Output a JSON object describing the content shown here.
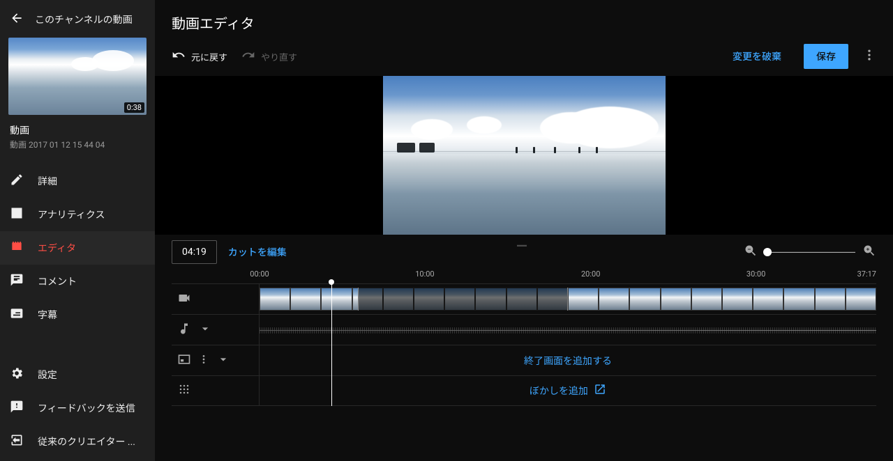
{
  "sidebar": {
    "back_label": "このチャンネルの動画",
    "thumb_duration": "0:38",
    "video_heading": "動画",
    "video_subtitle": "動画 2017 01 12 15 44 04",
    "items": [
      {
        "id": "details",
        "label": "詳細"
      },
      {
        "id": "analytics",
        "label": "アナリティクス"
      },
      {
        "id": "editor",
        "label": "エディタ"
      },
      {
        "id": "comments",
        "label": "コメント"
      },
      {
        "id": "subtitles",
        "label": "字幕"
      }
    ],
    "footer": [
      {
        "id": "settings",
        "label": "設定"
      },
      {
        "id": "feedback",
        "label": "フィードバックを送信"
      },
      {
        "id": "classic",
        "label": "従来のクリエイター ..."
      }
    ]
  },
  "header": {
    "title": "動画エディタ",
    "undo_label": "元に戻す",
    "redo_label": "やり直す",
    "discard_label": "変更を破棄",
    "save_label": "保存"
  },
  "controls": {
    "current_time": "04:19",
    "cut_label": "カットを編集"
  },
  "timeline": {
    "ticks": [
      {
        "pos": 0.0,
        "label": "00:00"
      },
      {
        "pos": 26.8,
        "label": "10:00"
      },
      {
        "pos": 53.7,
        "label": "20:00"
      },
      {
        "pos": 80.5,
        "label": "30:00"
      },
      {
        "pos": 100.0,
        "label": "37:17",
        "right": true
      }
    ],
    "playhead_percent": 11.6,
    "selection": {
      "start_percent": 16,
      "end_percent": 50
    },
    "filmstrip_frames": 20,
    "end_screen_label": "終了画面を追加する",
    "blur_label": "ぼかしを追加"
  },
  "icons": {
    "back": "arrow-left-icon",
    "undo": "undo-icon",
    "redo": "redo-icon",
    "more": "more-vert-icon",
    "video": "video-icon",
    "music": "music-icon",
    "endscreen": "end-screen-icon",
    "blur": "blur-icon",
    "open": "open-new-icon",
    "zoom_out": "zoom-out-icon",
    "zoom_in": "zoom-in-icon",
    "gear": "gear-icon",
    "feedback": "feedback-icon",
    "exit": "exit-icon",
    "pencil": "pencil-icon",
    "analytics": "analytics-icon",
    "editor": "editor-icon",
    "comments": "comments-icon",
    "subtitles": "subtitles-icon",
    "chevron": "chevron-down-icon"
  }
}
